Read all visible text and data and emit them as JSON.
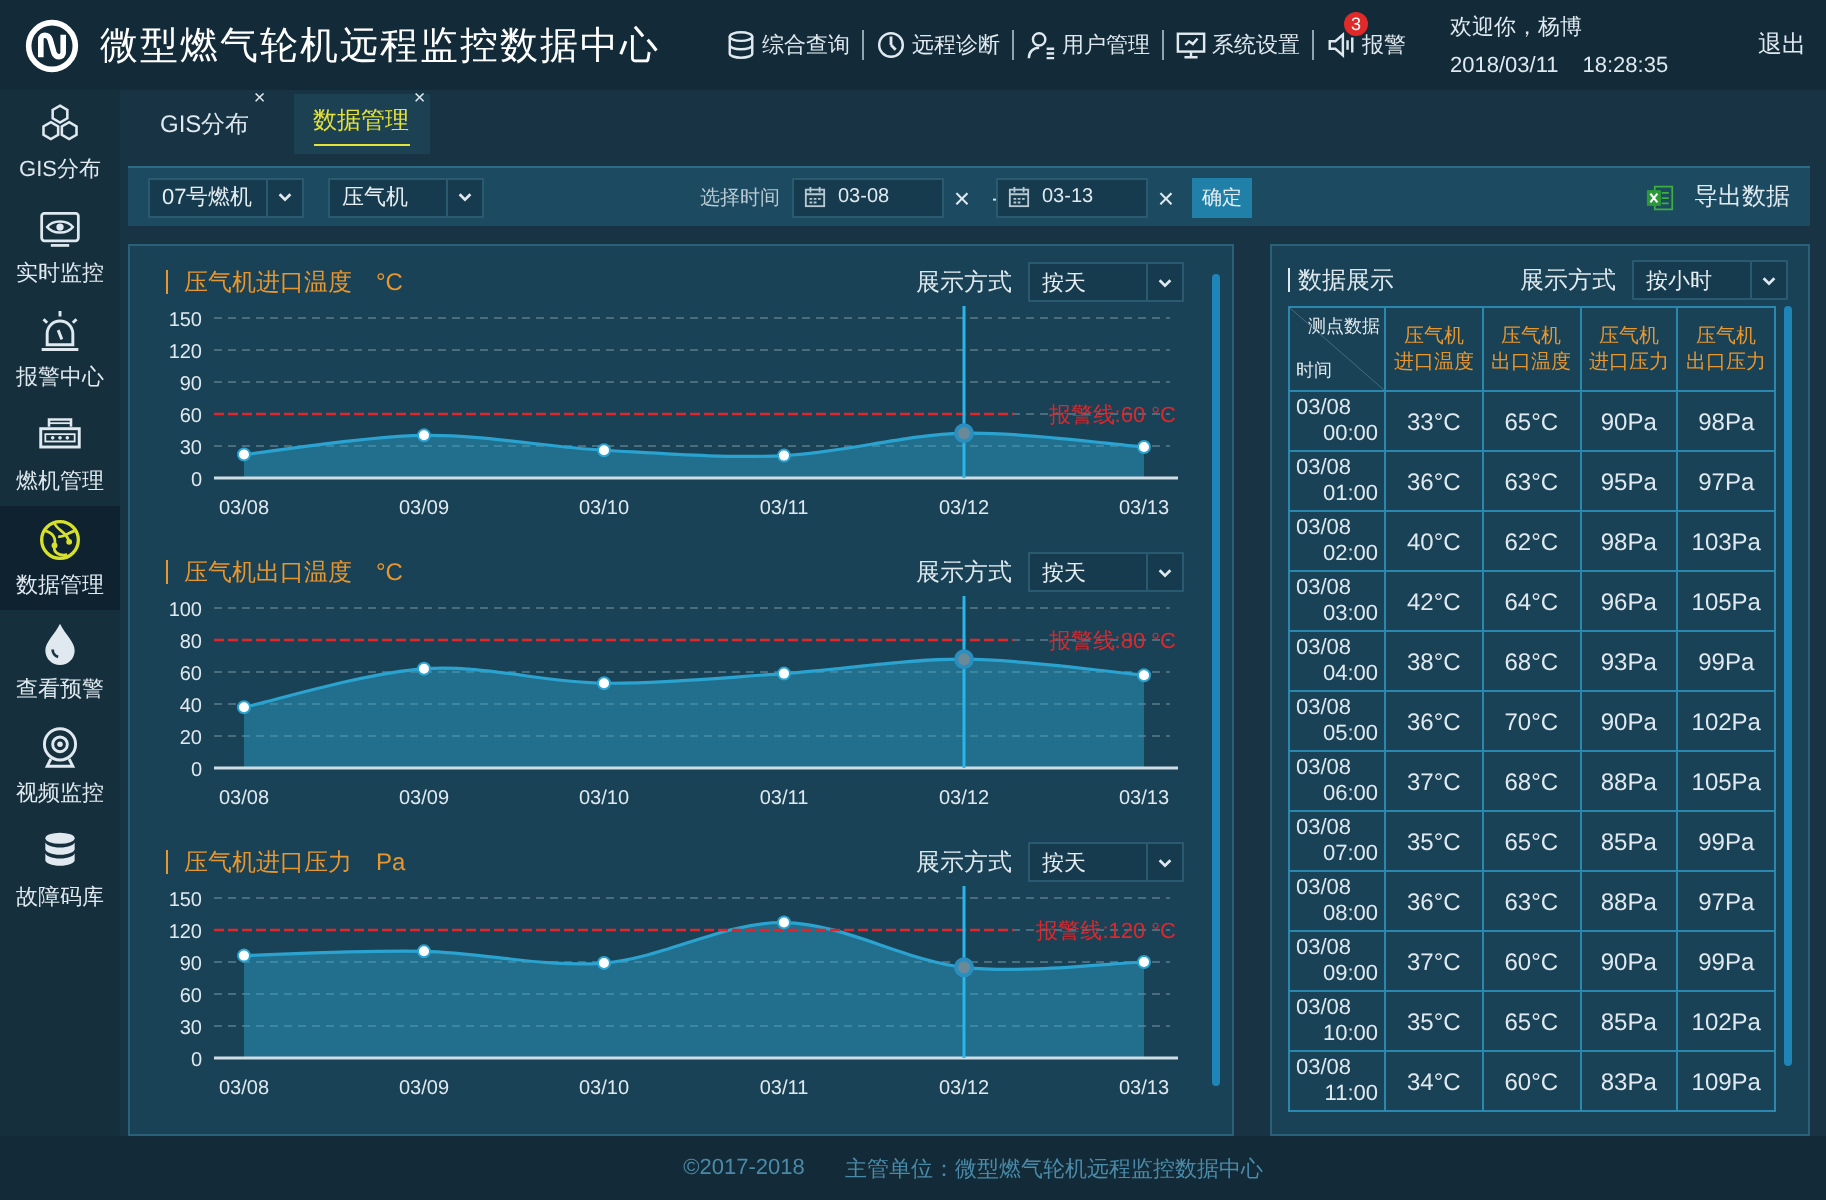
{
  "header": {
    "title": "微型燃气轮机远程监控数据中心",
    "nav": [
      {
        "label": "综合查询"
      },
      {
        "label": "远程诊断"
      },
      {
        "label": "用户管理"
      },
      {
        "label": "系统设置"
      },
      {
        "label": "报警",
        "badge": "3"
      }
    ],
    "welcome": "欢迎你，杨博",
    "date": "2018/03/11",
    "time": "18:28:35",
    "logout": "退出"
  },
  "sidebar": {
    "items": [
      {
        "label": "GIS分布",
        "selected": false
      },
      {
        "label": "实时监控",
        "selected": false
      },
      {
        "label": "报警中心",
        "selected": false
      },
      {
        "label": "燃机管理",
        "selected": false
      },
      {
        "label": "数据管理",
        "selected": true
      },
      {
        "label": "查看预警",
        "selected": false
      },
      {
        "label": "视频监控",
        "selected": false
      },
      {
        "label": "故障码库",
        "selected": false
      }
    ]
  },
  "tabs": [
    {
      "label": "GIS分布",
      "close": "×",
      "selected": false
    },
    {
      "label": "数据管理",
      "close": "×",
      "selected": true
    }
  ],
  "toolbar": {
    "unit": "07号燃机",
    "component": "压气机",
    "time_label": "选择时间",
    "start_date": "03-08",
    "start_clear": "×",
    "separator": "-",
    "end_date": "03-13",
    "end_clear": "×",
    "confirm": "确定",
    "export": "导出数据"
  },
  "charts": [
    {
      "unit": "°C",
      "display_label": "展示方式",
      "display_value": "按天",
      "chart_data": {
        "type": "area",
        "categories": [
          "03/08",
          "03/09",
          "03/10",
          "03/11",
          "03/12",
          "03/13"
        ],
        "series": [
          {
            "name": "压气机进口温度",
            "color": "#2aa3d0",
            "values": [
              22,
              40,
              26,
              21,
              42,
              29
            ]
          }
        ],
        "ylim": [
          0,
          150
        ],
        "yticks": [
          0,
          30,
          60,
          90,
          120,
          150
        ],
        "grid": true,
        "ref_lines": [
          {
            "axis": "y",
            "value": 60,
            "label": "报警线:60 °C",
            "color": "#e0262b"
          },
          {
            "axis": "x",
            "value": "03/12",
            "color": "#29b6ea"
          }
        ]
      }
    },
    {
      "unit": "°C",
      "display_label": "展示方式",
      "display_value": "按天",
      "chart_data": {
        "type": "area",
        "categories": [
          "03/08",
          "03/09",
          "03/10",
          "03/11",
          "03/12",
          "03/13"
        ],
        "series": [
          {
            "name": "压气机出口温度",
            "color": "#2aa3d0",
            "values": [
              38,
              62,
              53,
              59,
              68,
              58
            ]
          }
        ],
        "ylim": [
          0,
          100
        ],
        "yticks": [
          0,
          20,
          40,
          60,
          80,
          100
        ],
        "grid": true,
        "ref_lines": [
          {
            "axis": "y",
            "value": 80,
            "label": "报警线:80 °C",
            "color": "#e0262b"
          },
          {
            "axis": "x",
            "value": "03/12",
            "color": "#29b6ea"
          }
        ]
      }
    },
    {
      "unit": "Pa",
      "display_label": "展示方式",
      "display_value": "按天",
      "chart_data": {
        "type": "area",
        "categories": [
          "03/08",
          "03/09",
          "03/10",
          "03/11",
          "03/12",
          "03/13"
        ],
        "series": [
          {
            "name": "压气机进口压力",
            "color": "#2aa3d0",
            "values": [
              96,
              100,
              89,
              127,
              85,
              90
            ]
          }
        ],
        "ylim": [
          0,
          150
        ],
        "yticks": [
          0,
          30,
          60,
          90,
          120,
          150
        ],
        "grid": true,
        "ref_lines": [
          {
            "axis": "y",
            "value": 120,
            "label": "报警线:120 °C",
            "color": "#e0262b"
          },
          {
            "axis": "x",
            "value": "03/12",
            "color": "#29b6ea"
          }
        ]
      }
    }
  ],
  "table_panel": {
    "title": "数据展示",
    "display_label": "展示方式",
    "display_value": "按小时",
    "corner_top": "测点数据",
    "corner_bottom": "时间",
    "columns": [
      {
        "lines": [
          "压气机",
          "进口温度"
        ]
      },
      {
        "lines": [
          "压气机",
          "出口温度"
        ]
      },
      {
        "lines": [
          "压气机",
          "进口压力"
        ]
      },
      {
        "lines": [
          "压气机",
          "出口压力"
        ]
      }
    ],
    "rows": [
      {
        "date": "03/08",
        "time": "00:00",
        "cells": [
          "33°C",
          "65°C",
          "90Pa",
          "98Pa"
        ]
      },
      {
        "date": "03/08",
        "time": "01:00",
        "cells": [
          "36°C",
          "63°C",
          "95Pa",
          "97Pa"
        ]
      },
      {
        "date": "03/08",
        "time": "02:00",
        "cells": [
          "40°C",
          "62°C",
          "98Pa",
          "103Pa"
        ]
      },
      {
        "date": "03/08",
        "time": "03:00",
        "cells": [
          "42°C",
          "64°C",
          "96Pa",
          "105Pa"
        ]
      },
      {
        "date": "03/08",
        "time": "04:00",
        "cells": [
          "38°C",
          "68°C",
          "93Pa",
          "99Pa"
        ]
      },
      {
        "date": "03/08",
        "time": "05:00",
        "cells": [
          "36°C",
          "70°C",
          "90Pa",
          "102Pa"
        ]
      },
      {
        "date": "03/08",
        "time": "06:00",
        "cells": [
          "37°C",
          "68°C",
          "88Pa",
          "105Pa"
        ]
      },
      {
        "date": "03/08",
        "time": "07:00",
        "cells": [
          "35°C",
          "65°C",
          "85Pa",
          "99Pa"
        ]
      },
      {
        "date": "03/08",
        "time": "08:00",
        "cells": [
          "36°C",
          "63°C",
          "88Pa",
          "97Pa"
        ]
      },
      {
        "date": "03/08",
        "time": "09:00",
        "cells": [
          "37°C",
          "60°C",
          "90Pa",
          "99Pa"
        ]
      },
      {
        "date": "03/08",
        "time": "10:00",
        "cells": [
          "35°C",
          "65°C",
          "85Pa",
          "102Pa"
        ]
      },
      {
        "date": "03/08",
        "time": "11:00",
        "cells": [
          "34°C",
          "60°C",
          "83Pa",
          "109Pa"
        ]
      }
    ]
  },
  "footer": {
    "copyright": "©2017-2018",
    "org": "主管单位：微型燃气轮机远程监控数据中心"
  }
}
